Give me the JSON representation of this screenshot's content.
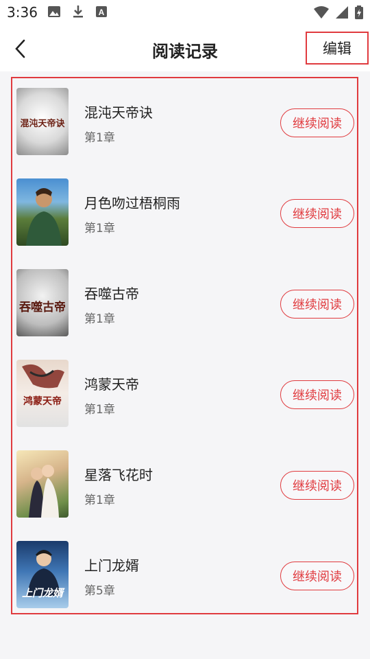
{
  "status_bar": {
    "time": "3:36",
    "left_icons": [
      "image-icon",
      "download-icon",
      "a-box-icon"
    ],
    "right_icons": [
      "wifi-icon",
      "signal-icon",
      "battery-icon"
    ]
  },
  "header": {
    "title": "阅读记录",
    "edit_label": "编辑"
  },
  "colors": {
    "accent": "#e03a3e",
    "background": "#f5f5f7"
  },
  "books": [
    {
      "title": "混沌天帝诀",
      "chapter": "第1章",
      "button": "继续阅读",
      "cover_text": "混沌天帝诀"
    },
    {
      "title": "月色吻过梧桐雨",
      "chapter": "第1章",
      "button": "继续阅读",
      "cover_text": ""
    },
    {
      "title": "吞噬古帝",
      "chapter": "第1章",
      "button": "继续阅读",
      "cover_text": "吞噬古帝"
    },
    {
      "title": "鸿蒙天帝",
      "chapter": "第1章",
      "button": "继续阅读",
      "cover_text": "鸿蒙天帝"
    },
    {
      "title": "星落飞花时",
      "chapter": "第1章",
      "button": "继续阅读",
      "cover_text": ""
    },
    {
      "title": "上门龙婿",
      "chapter": "第5章",
      "button": "继续阅读",
      "cover_text": "上门龙婿"
    }
  ]
}
